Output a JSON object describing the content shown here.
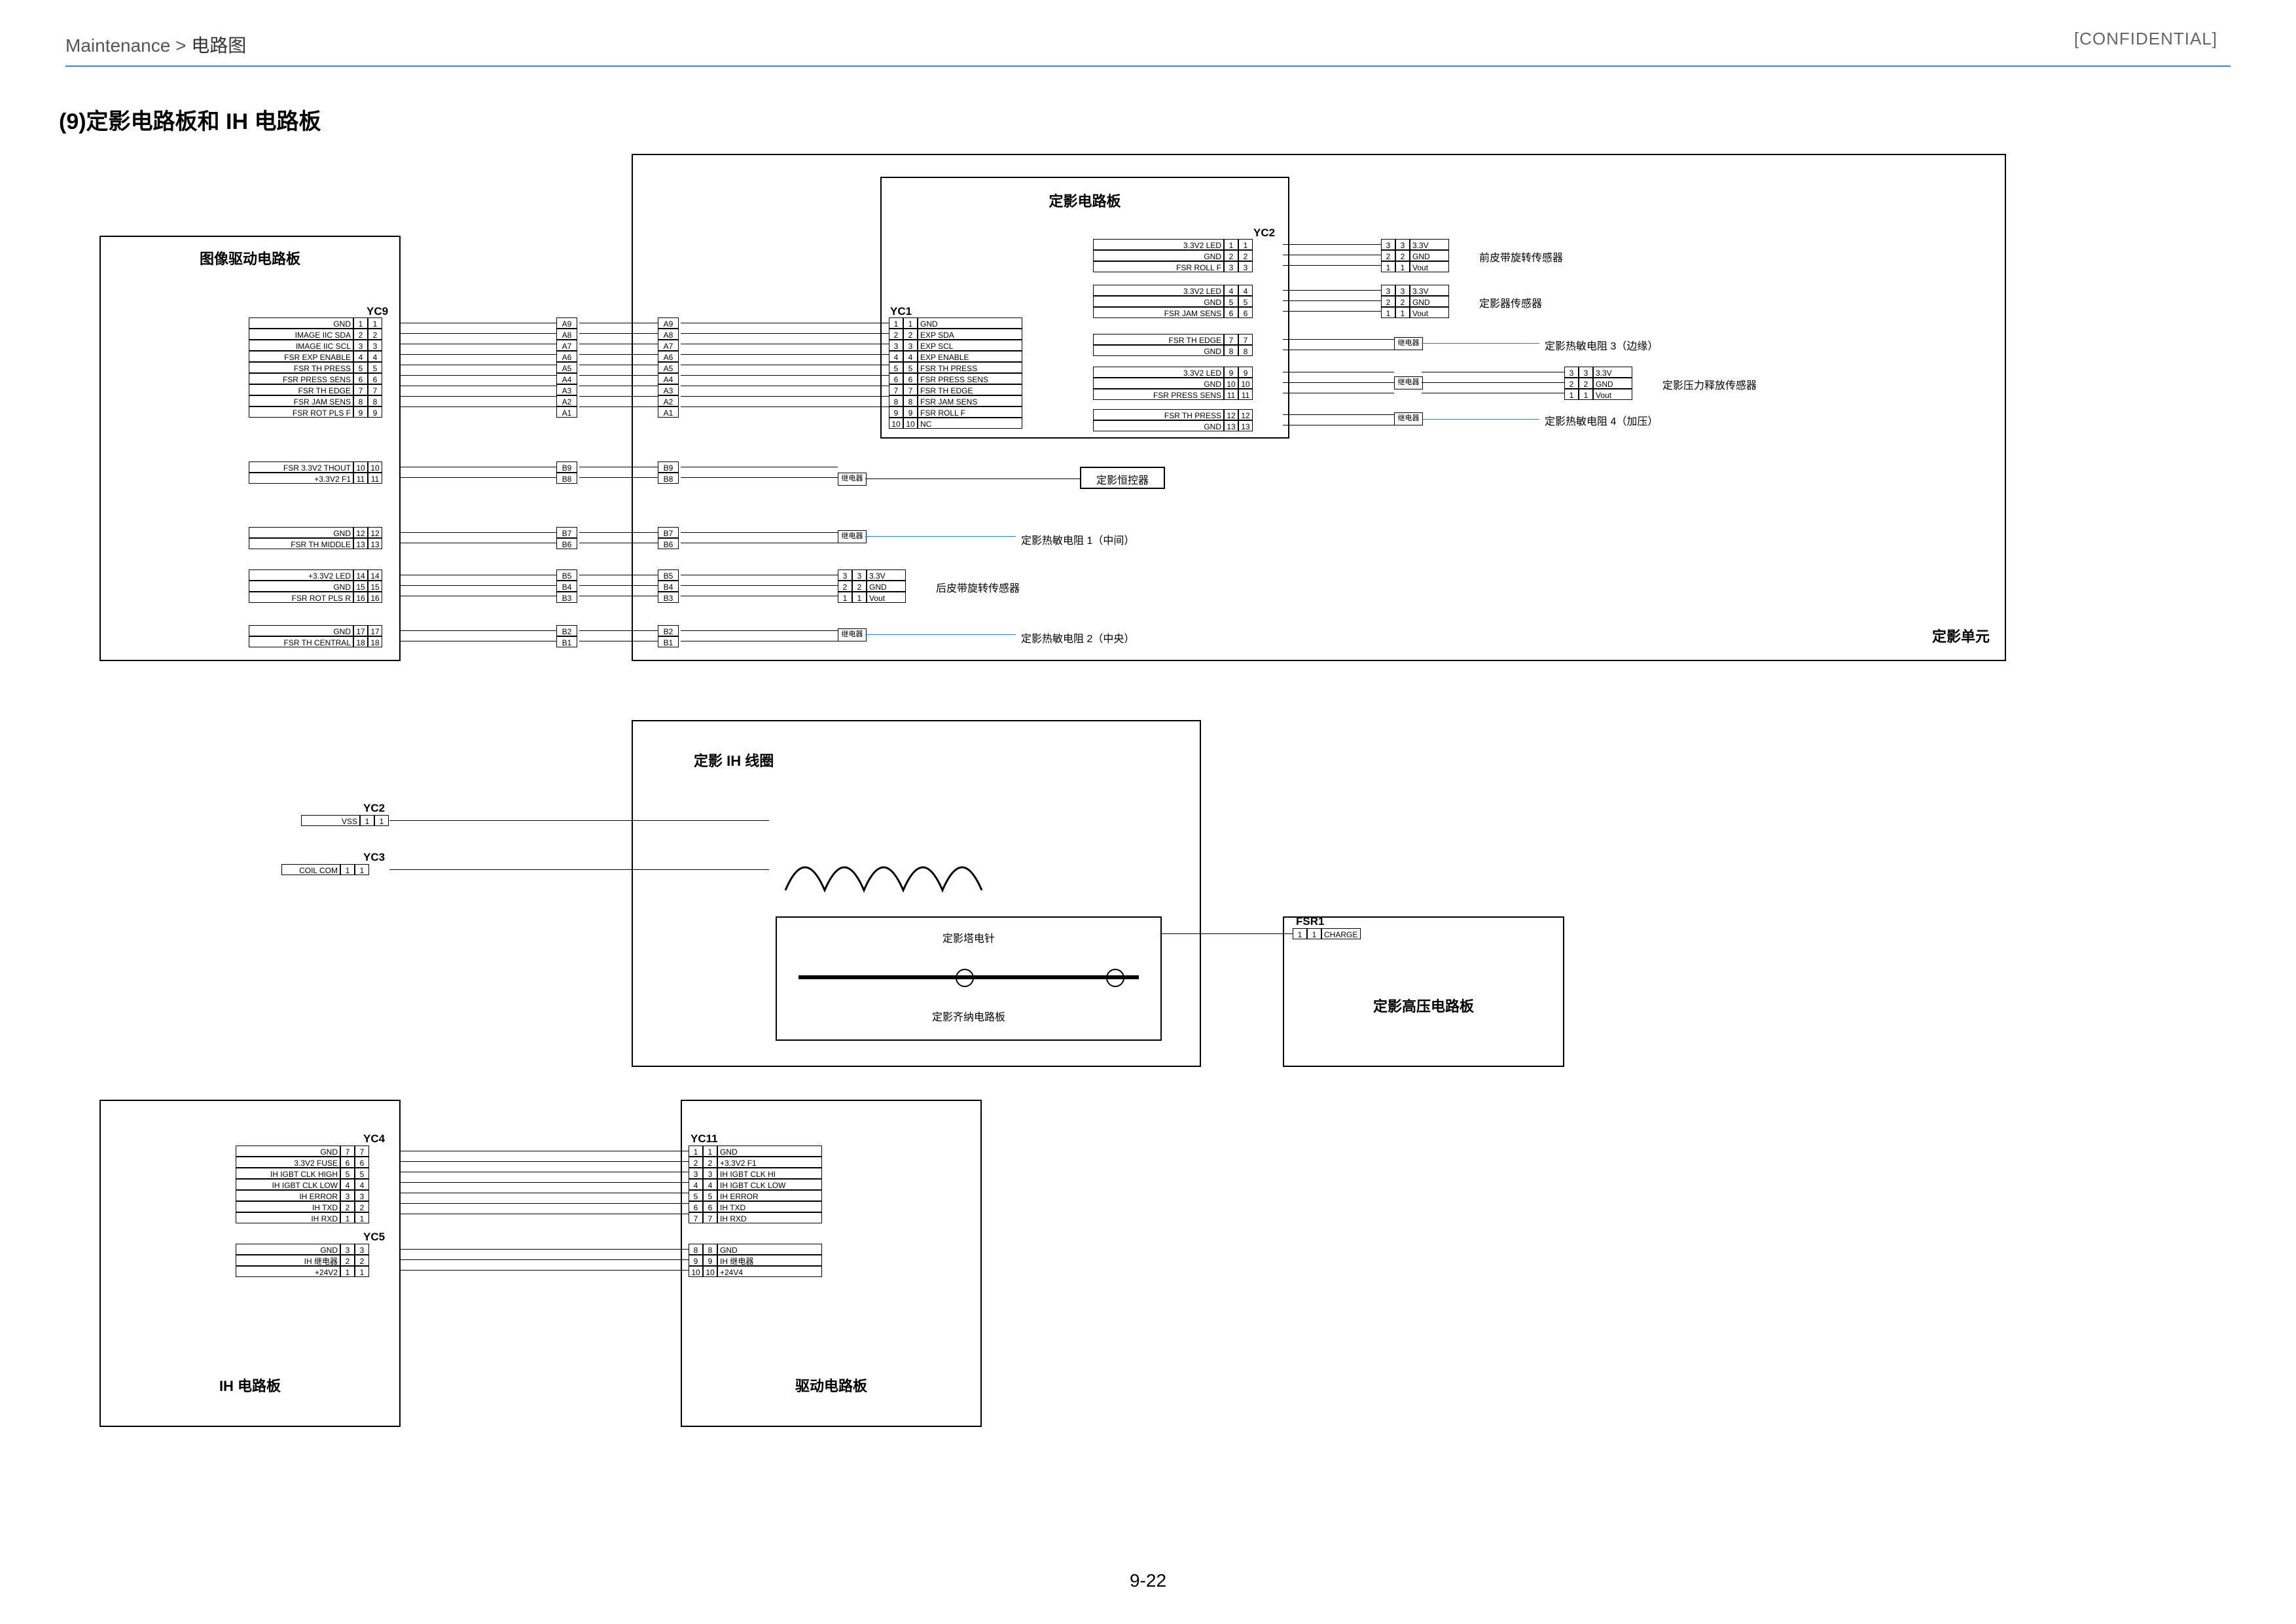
{
  "header": {
    "breadcrumb_prefix": "Maintenance",
    "breadcrumb_sep": " > ",
    "breadcrumb_page": "电路图",
    "confidential": "[CONFIDENTIAL]"
  },
  "figure_title": "(9)定影电路板和 IH 电路板",
  "page_number": "9-22",
  "boards": {
    "img_drive": "图像驱动电路板",
    "fuser_pcb": "定影电路板",
    "fuser_unit": "定影单元",
    "ih_coil": "定影 IH 线圈",
    "ih_board": "IH 电路板",
    "drive_board": "驱动电路板",
    "ih_pcba_sub": "定影齐纳电路板",
    "ih_electrode": "定影塔电针",
    "ih_hv": "定影高压电路板",
    "frontbelt": "前皮带旋转传感器",
    "rearbelt": "后皮带旋转传感器",
    "fsr_sens": "定影器传感器",
    "press_rel": "定影压力释放传感器",
    "therm3": "定影热敏电阻 3（边缘）",
    "therm4": "定影热敏电阻 4（加压）",
    "thermostat": "定影恒控器",
    "therm1": "定影热敏电阻 1（中间）",
    "therm2": "定影热敏电阻 2（中央）"
  },
  "relay_label": "继电器",
  "conns": {
    "yc9": "YC9",
    "yc1": "YC1",
    "yc2": "YC2",
    "yc2b": "YC2",
    "yc3": "YC3",
    "yc4": "YC4",
    "yc5": "YC5",
    "yc11": "YC11",
    "fsr1": "FSR1"
  },
  "yc9_left": [
    {
      "n": "1",
      "s": "GND"
    },
    {
      "n": "2",
      "s": "IMAGE IIC SDA"
    },
    {
      "n": "3",
      "s": "IMAGE IIC SCL"
    },
    {
      "n": "4",
      "s": "FSR EXP ENABLE"
    },
    {
      "n": "5",
      "s": "FSR TH PRESS"
    },
    {
      "n": "6",
      "s": "FSR PRESS SENS"
    },
    {
      "n": "7",
      "s": "FSR TH EDGE"
    },
    {
      "n": "8",
      "s": "FSR JAM SENS"
    },
    {
      "n": "9",
      "s": "FSR ROT PLS F"
    }
  ],
  "yc9_left_b": [
    {
      "n": "10",
      "s": "FSR 3.3V2 THOUT"
    },
    {
      "n": "11",
      "s": "+3.3V2 F1"
    }
  ],
  "yc9_left_c": [
    {
      "n": "12",
      "s": "GND"
    },
    {
      "n": "13",
      "s": "FSR TH MIDDLE"
    }
  ],
  "yc9_left_d": [
    {
      "n": "14",
      "s": "+3.3V2 LED"
    },
    {
      "n": "15",
      "s": "GND"
    },
    {
      "n": "16",
      "s": "FSR ROT PLS R"
    }
  ],
  "yc9_left_e": [
    {
      "n": "17",
      "s": "GND"
    },
    {
      "n": "18",
      "s": "FSR TH CENTRAL"
    }
  ],
  "mid_pins_a": [
    "A9",
    "A8",
    "A7",
    "A6",
    "A5",
    "A4",
    "A3",
    "A2",
    "A1"
  ],
  "mid_pins_b": [
    "B9",
    "B8"
  ],
  "mid_pins_c": [
    "B7",
    "B6"
  ],
  "mid_pins_d": [
    "B5",
    "B4",
    "B3"
  ],
  "mid_pins_e": [
    "B2",
    "B1"
  ],
  "yc1_right": [
    {
      "n": "1",
      "s": "GND"
    },
    {
      "n": "2",
      "s": "EXP SDA"
    },
    {
      "n": "3",
      "s": "EXP SCL"
    },
    {
      "n": "4",
      "s": "EXP ENABLE"
    },
    {
      "n": "5",
      "s": "FSR TH PRESS"
    },
    {
      "n": "6",
      "s": "FSR PRESS SENS"
    },
    {
      "n": "7",
      "s": "FSR TH EDGE"
    },
    {
      "n": "8",
      "s": "FSR JAM SENS"
    },
    {
      "n": "9",
      "s": "FSR ROLL F"
    },
    {
      "n": "10",
      "s": "NC"
    }
  ],
  "yc2_top": [
    {
      "n": "1",
      "s": "3.3V2 LED"
    },
    {
      "n": "2",
      "s": "GND"
    },
    {
      "n": "3",
      "s": "FSR ROLL F"
    }
  ],
  "yc2_mid": [
    {
      "n": "4",
      "s": "3.3V2 LED"
    },
    {
      "n": "5",
      "s": "GND"
    },
    {
      "n": "6",
      "s": "FSR JAM SENS"
    }
  ],
  "yc2_th3": [
    {
      "n": "7",
      "s": "FSR TH EDGE"
    },
    {
      "n": "8",
      "s": "GND"
    }
  ],
  "yc2_sens": [
    {
      "n": "9",
      "s": "3.3V2 LED"
    },
    {
      "n": "10",
      "s": "GND"
    },
    {
      "n": "11",
      "s": "FSR PRESS SENS"
    }
  ],
  "yc2_th4": [
    {
      "n": "12",
      "s": "FSR TH PRESS"
    },
    {
      "n": "13",
      "s": "GND"
    }
  ],
  "sensor3_pins": [
    {
      "n": "3",
      "s": "3.3V"
    },
    {
      "n": "2",
      "s": "GND"
    },
    {
      "n": "1",
      "s": "Vout"
    }
  ],
  "press_rel_pins": [
    {
      "n": "3",
      "s": "3.3V"
    },
    {
      "n": "2",
      "s": "GND"
    },
    {
      "n": "1",
      "s": "Vout"
    }
  ],
  "rearbelt_pins": [
    {
      "n": "3",
      "s": "3.3V"
    },
    {
      "n": "2",
      "s": "GND"
    },
    {
      "n": "1",
      "s": "Vout"
    }
  ],
  "yc2b_left": [
    {
      "n": "1",
      "s": "VSS"
    }
  ],
  "yc3_left": [
    {
      "n": "1",
      "s": "COIL COM"
    }
  ],
  "fsr1_pin": [
    {
      "n": "1",
      "s": "CHARGE"
    }
  ],
  "yc4": [
    {
      "n": "7",
      "s": "GND"
    },
    {
      "n": "6",
      "s": "3.3V2 FUSE"
    },
    {
      "n": "5",
      "s": "IH IGBT CLK HIGH"
    },
    {
      "n": "4",
      "s": "IH IGBT CLK LOW"
    },
    {
      "n": "3",
      "s": "IH ERROR"
    },
    {
      "n": "2",
      "s": "IH TXD"
    },
    {
      "n": "1",
      "s": "IH RXD"
    }
  ],
  "yc5": [
    {
      "n": "3",
      "s": "GND"
    },
    {
      "n": "2",
      "s": "IH 继电器"
    },
    {
      "n": "1",
      "s": "+24V2"
    }
  ],
  "yc11": [
    {
      "n": "1",
      "s": "GND"
    },
    {
      "n": "2",
      "s": "+3.3V2 F1"
    },
    {
      "n": "3",
      "s": "IH IGBT CLK HI"
    },
    {
      "n": "4",
      "s": "IH IGBT CLK LOW"
    },
    {
      "n": "5",
      "s": "IH ERROR"
    },
    {
      "n": "6",
      "s": "IH TXD"
    },
    {
      "n": "7",
      "s": "IH RXD"
    }
  ],
  "yc11b": [
    {
      "n": "8",
      "s": "GND"
    },
    {
      "n": "9",
      "s": "IH 继电器"
    },
    {
      "n": "10",
      "s": "+24V4"
    }
  ]
}
